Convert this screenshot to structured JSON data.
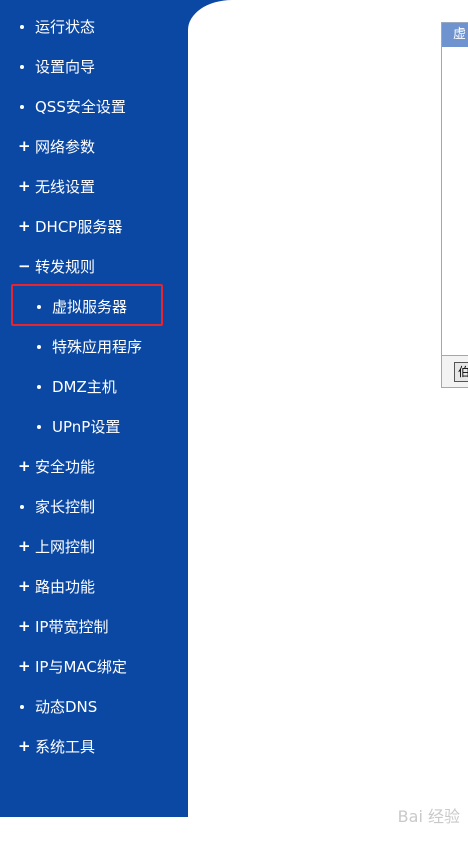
{
  "sidebar": {
    "items": [
      {
        "label": "运行状态",
        "marker": "dot",
        "level": 1
      },
      {
        "label": "设置向导",
        "marker": "dot",
        "level": 1
      },
      {
        "label": "QSS安全设置",
        "marker": "dot",
        "level": 1
      },
      {
        "label": "网络参数",
        "marker": "plus",
        "level": 1
      },
      {
        "label": "无线设置",
        "marker": "plus",
        "level": 1
      },
      {
        "label": "DHCP服务器",
        "marker": "plus",
        "level": 1
      },
      {
        "label": "转发规则",
        "marker": "minus",
        "level": 1
      },
      {
        "label": "虚拟服务器",
        "marker": "dot",
        "level": 2,
        "selected": true
      },
      {
        "label": "特殊应用程序",
        "marker": "dot",
        "level": 2
      },
      {
        "label": "DMZ主机",
        "marker": "dot",
        "level": 2
      },
      {
        "label": "UPnP设置",
        "marker": "dot",
        "level": 2
      },
      {
        "label": "安全功能",
        "marker": "plus",
        "level": 1
      },
      {
        "label": "家长控制",
        "marker": "dot",
        "level": 1
      },
      {
        "label": "上网控制",
        "marker": "plus",
        "level": 1
      },
      {
        "label": "路由功能",
        "marker": "plus",
        "level": 1
      },
      {
        "label": "IP带宽控制",
        "marker": "plus",
        "level": 1
      },
      {
        "label": "IP与MAC绑定",
        "marker": "plus",
        "level": 1
      },
      {
        "label": "动态DNS",
        "marker": "dot",
        "level": 1
      },
      {
        "label": "系统工具",
        "marker": "plus",
        "level": 1
      }
    ]
  },
  "panel": {
    "header_label": "虚",
    "footer_button_label": "伯"
  },
  "watermark": {
    "text": "Bai 经验"
  },
  "colors": {
    "sidebar_bg": "#0b48a3",
    "highlight_border": "#e8242e",
    "panel_header_bg": "#6f93cf"
  }
}
